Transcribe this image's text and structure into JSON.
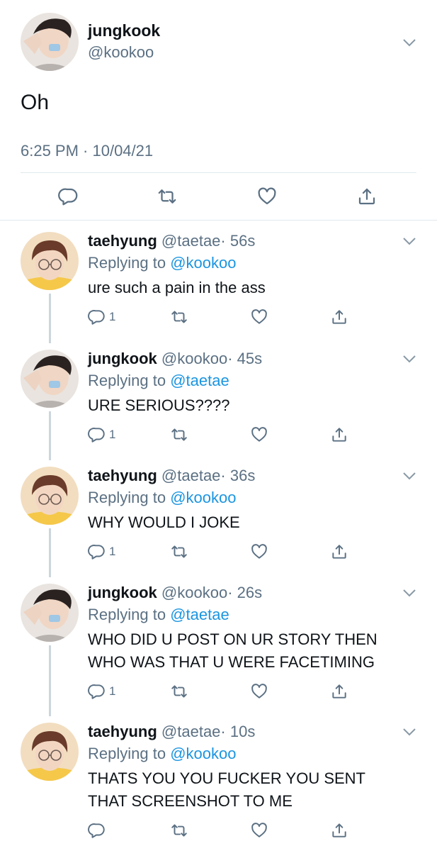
{
  "main_tweet": {
    "name": "jungkook",
    "handle": "@kookoo",
    "text": "Oh",
    "timestamp": "6:25 PM · 10/04/21"
  },
  "replies": [
    {
      "name": "taehyung",
      "handle": "@taetae",
      "time": "· 56s",
      "replying_prefix": "Replying to",
      "replying_to": "@kookoo",
      "lines": [
        "ure such a pain in the ass"
      ],
      "reply_count": "1",
      "avatar": "taehyung"
    },
    {
      "name": "jungkook",
      "handle": "@kookoo",
      "time": "· 45s",
      "replying_prefix": "Replying to",
      "replying_to": "@taetae",
      "lines": [
        "URE SERIOUS????"
      ],
      "reply_count": "1",
      "avatar": "jungkook"
    },
    {
      "name": "taehyung",
      "handle": "@taetae",
      "time": "· 36s",
      "replying_prefix": "Replying to",
      "replying_to": "@kookoo",
      "lines": [
        "WHY WOULD I JOKE"
      ],
      "reply_count": "1",
      "avatar": "taehyung"
    },
    {
      "name": "jungkook",
      "handle": "@kookoo",
      "time": "· 26s",
      "replying_prefix": "Replying to",
      "replying_to": "@taetae",
      "lines": [
        "WHO DID U POST ON UR STORY THEN",
        "WHO WAS THAT U WERE FACETIMING"
      ],
      "reply_count": "1",
      "avatar": "jungkook"
    },
    {
      "name": "taehyung",
      "handle": "@taetae",
      "time": "· 10s",
      "replying_prefix": "Replying to",
      "replying_to": "@kookoo",
      "lines": [
        "THATS YOU YOU FUCKER YOU SENT",
        "THAT SCREENSHOT TO ME"
      ],
      "reply_count": "",
      "avatar": "taehyung"
    }
  ],
  "icons": {
    "reply": "reply-icon",
    "retweet": "retweet-icon",
    "like": "like-icon",
    "share": "share-icon",
    "more": "chevron-down-icon"
  },
  "colors": {
    "text": "#0f1419",
    "secondary": "#5b7083",
    "mention": "#1b95e0",
    "divider": "#e1e8ed",
    "thread_line": "#ccd6dd"
  }
}
